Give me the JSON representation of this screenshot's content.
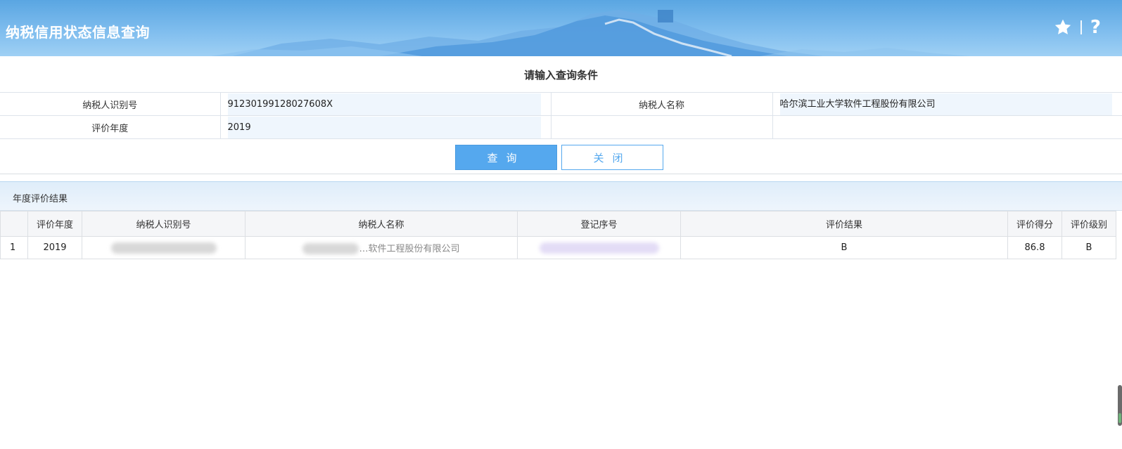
{
  "header": {
    "title": "纳税信用状态信息查询",
    "icons": [
      "star-icon",
      "help-icon"
    ],
    "help_glyph": "?"
  },
  "query": {
    "title": "请输入查询条件",
    "taxpayer_id_label": "纳税人识别号",
    "taxpayer_id_value": "91230199128027608X",
    "taxpayer_name_label": "纳税人名称",
    "taxpayer_name_value": "哈尔滨工业大学软件工程股份有限公司",
    "year_label": "评价年度",
    "year_value": "2019"
  },
  "buttons": {
    "search": "查询",
    "close": "关闭"
  },
  "results": {
    "title": "年度评价结果",
    "columns": [
      "",
      "评价年度",
      "纳税人识别号",
      "纳税人名称",
      "登记序号",
      "评价结果",
      "评价得分",
      "评价级别"
    ],
    "rows": [
      {
        "index": "1",
        "year": "2019",
        "taxpayer_id": "",
        "taxpayer_name": "…软件工程股份有限公司",
        "reg_no": "",
        "result": "B",
        "score": "86.8",
        "level": "B"
      }
    ]
  },
  "colors": {
    "primary": "#55a8ee",
    "header_top": "#5aa6e2",
    "input_bg": "#eff6fd"
  }
}
